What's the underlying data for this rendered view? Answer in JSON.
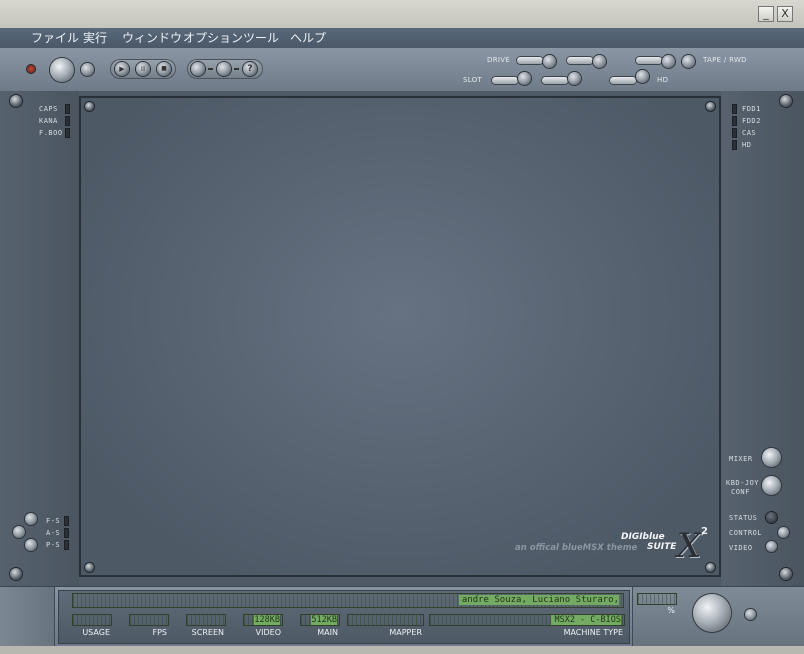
{
  "window": {
    "minimize_glyph": "_",
    "close_glyph": "X"
  },
  "menu": [
    "ファイル",
    "実行",
    "ウィンドウ",
    "オプション",
    "ツール",
    "ヘルプ"
  ],
  "toolbar": {
    "drive_label": "DRIVE",
    "slot_label": "SLOT",
    "tape_label": "TAPE / RWD",
    "hd_label": "HD",
    "play_glyph": "▶",
    "pause_glyph": "II",
    "stop_glyph": "■",
    "help_glyph": "?"
  },
  "left_indicators": [
    "CAPS",
    "KANA",
    "F.BOO"
  ],
  "left_bottom_indicators": [
    "F-S",
    "A-S",
    "P-S"
  ],
  "right_indicators": [
    "FDD1",
    "FDD2",
    "CAS",
    "HD"
  ],
  "right_controls": {
    "mixer": "MIXER",
    "kbd_joy_line1": "KBD-JOY",
    "kbd_joy_line2": "CONF",
    "status": "STATUS",
    "control": "CONTROL",
    "video": "VIDEO"
  },
  "branding": {
    "line1": "DIGIblue",
    "line2": "SUITE",
    "mark": "X",
    "superscript": "2",
    "tagline": "an offical blueMSX theme"
  },
  "status": {
    "credits": "andre Souza, Luciano Sturaro,",
    "usage_label": "USAGE",
    "fps_label": "FPS",
    "screen_label": "SCREEN",
    "video_label": "VIDEO",
    "video_value": "128KB",
    "main_label": "MAIN",
    "main_value": "512KB",
    "mapper_label": "MAPPER",
    "machine_type_label": "MACHINE TYPE",
    "machine_type_value": "MSX2 - C-BIOS",
    "percent_label": "%"
  },
  "colors": {
    "lcd_green": "#74ab62",
    "panel_blue_gray": "#4f5a66",
    "menu_bg": "#52606f"
  }
}
